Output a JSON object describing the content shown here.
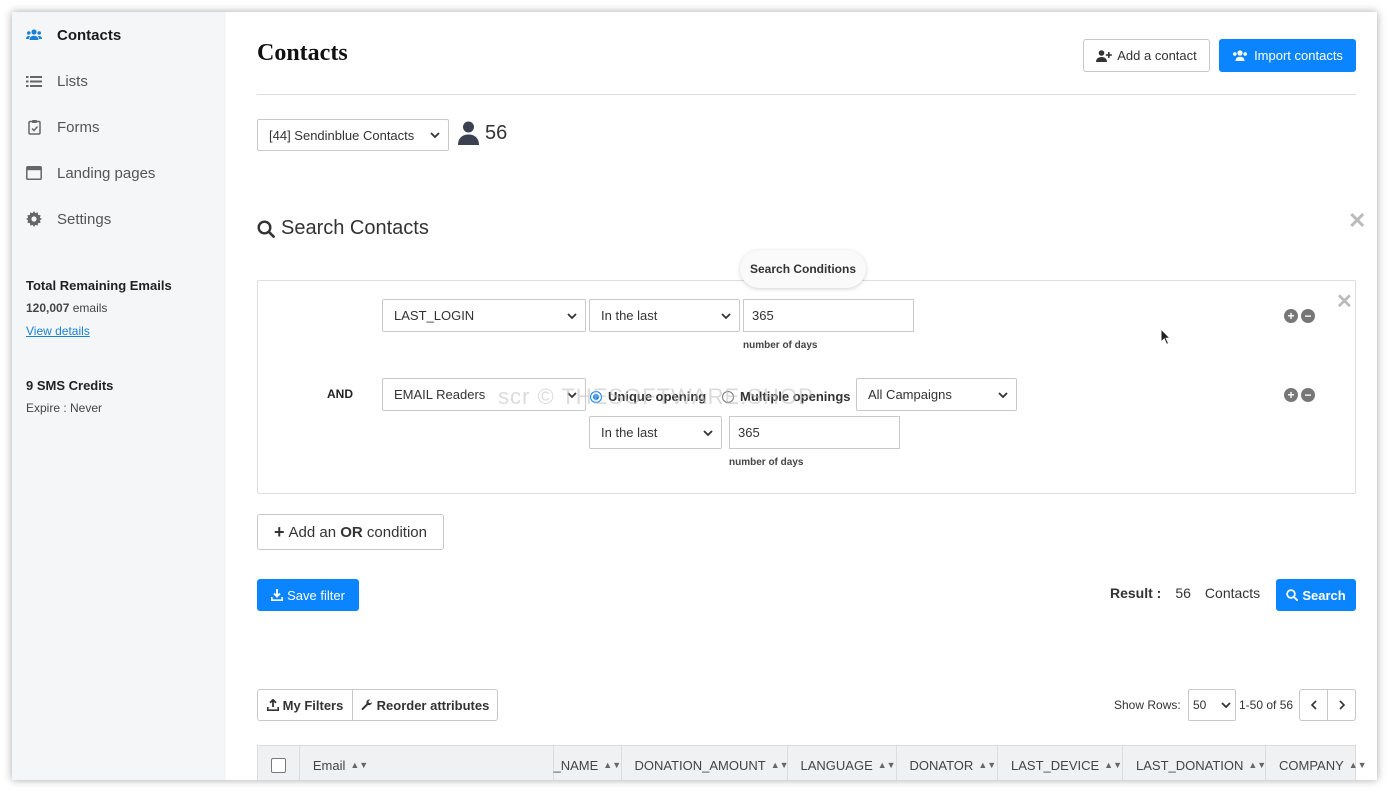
{
  "sidebar": {
    "items": [
      {
        "label": "Contacts",
        "icon": "users-icon",
        "active": true
      },
      {
        "label": "Lists",
        "icon": "list-icon"
      },
      {
        "label": "Forms",
        "icon": "clipboard-icon"
      },
      {
        "label": "Landing pages",
        "icon": "browser-window-icon"
      },
      {
        "label": "Settings",
        "icon": "gear-icon"
      }
    ],
    "emails_title": "Total Remaining Emails",
    "emails_count": "120,007",
    "emails_unit": "emails",
    "view_details": "View details",
    "sms_title": "9 SMS Credits",
    "sms_expire": "Expire : Never"
  },
  "header": {
    "title": "Contacts",
    "add_contact": "Add a contact",
    "import_contacts": "Import contacts"
  },
  "list_select": {
    "value": "[44] Sendinblue Contacts",
    "count": "56"
  },
  "search": {
    "title": "Search Contacts",
    "conditions_label": "Search Conditions",
    "condition1": {
      "attribute": "LAST_LOGIN",
      "operator": "In the last",
      "value": "365",
      "hint": "number of days"
    },
    "condition2": {
      "connector": "AND",
      "attribute": "EMAIL Readers",
      "radio_unique": "Unique opening",
      "radio_multiple": "Multiple openings",
      "campaigns": "All Campaigns",
      "operator": "In the last",
      "value": "365",
      "hint": "number of days"
    },
    "add_or_prefix": "Add an ",
    "add_or_bold": "OR",
    "add_or_suffix": " condition",
    "save_filter": "Save filter",
    "result_label": "Result :",
    "result_count": "56",
    "result_unit": "Contacts",
    "search_button": "Search"
  },
  "watermark": "scr © THESOFTWARE.SHOP",
  "table": {
    "my_filters": "My Filters",
    "reorder": "Reorder attributes",
    "show_rows_label": "Show Rows:",
    "rows_value": "50",
    "range": "1-50 of 56",
    "columns": [
      "Email",
      "_NAME",
      "DONATION_AMOUNT",
      "LANGUAGE",
      "DONATOR",
      "LAST_DEVICE",
      "LAST_DONATION",
      "COMPANY"
    ]
  },
  "colors": {
    "primary": "#0a84ff",
    "sidebar_bg": "#f5f6f8"
  }
}
